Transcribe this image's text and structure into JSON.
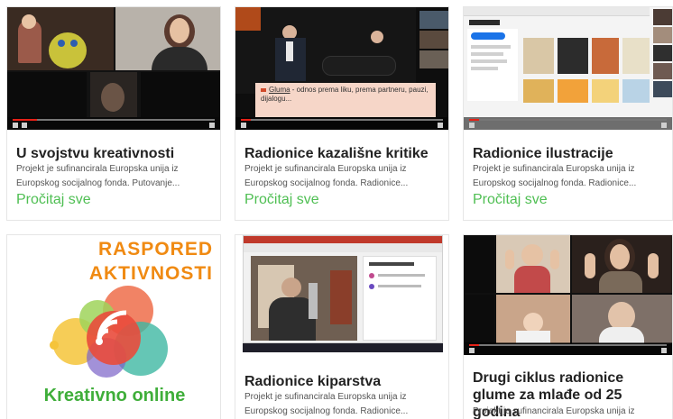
{
  "cards": [
    {
      "title": "U svojstvu kreativnosti",
      "excerpt": "Projekt je sufinancirala Europska unija iz Europskog socijalnog fonda. Putovanje...",
      "more": "Pročitaj sve",
      "progress": 0.12
    },
    {
      "title": "Radionice kazališne kritike",
      "excerpt": "Projekt je sufinancirala Europska unija iz Europskog socijalnog fonda. Radionice...",
      "more": "Pročitaj sve",
      "caption": "Gluma - odnos prema liku, prema partneru, pauzi, dijalogu...",
      "caption_keyword": "Gluma",
      "progress": 0.05
    },
    {
      "title": "Radionice ilustracije",
      "excerpt": "Projekt je sufinancirala Europska unija iz Europskog socijalnog fonda. Radionice...",
      "more": "Pročitaj sve",
      "progress": 0.05
    },
    {
      "poster_title": "RASPORED AKTIVNOSTI",
      "poster_brand": "Kreativno online"
    },
    {
      "title": "Radionice kiparstva",
      "excerpt": "Projekt je sufinancirala Europska unija iz Europskog socijalnog fonda. Radionice..."
    },
    {
      "title": "Drugi ciklus radionice glume za mlađe od 25 godina",
      "excerpt": "Projekt je sufinancirala Europska unija iz Europskog",
      "progress": 0.05
    }
  ],
  "colors": {
    "link": "#4fbf53",
    "title": "#222222",
    "excerpt": "#555555",
    "poster_orange": "#f08a12",
    "poster_green": "#3fae3a",
    "progress_red": "#e62117"
  },
  "icons": [
    "broadcast-waves-icon",
    "play-icon",
    "volume-icon",
    "fullscreen-icon"
  ]
}
